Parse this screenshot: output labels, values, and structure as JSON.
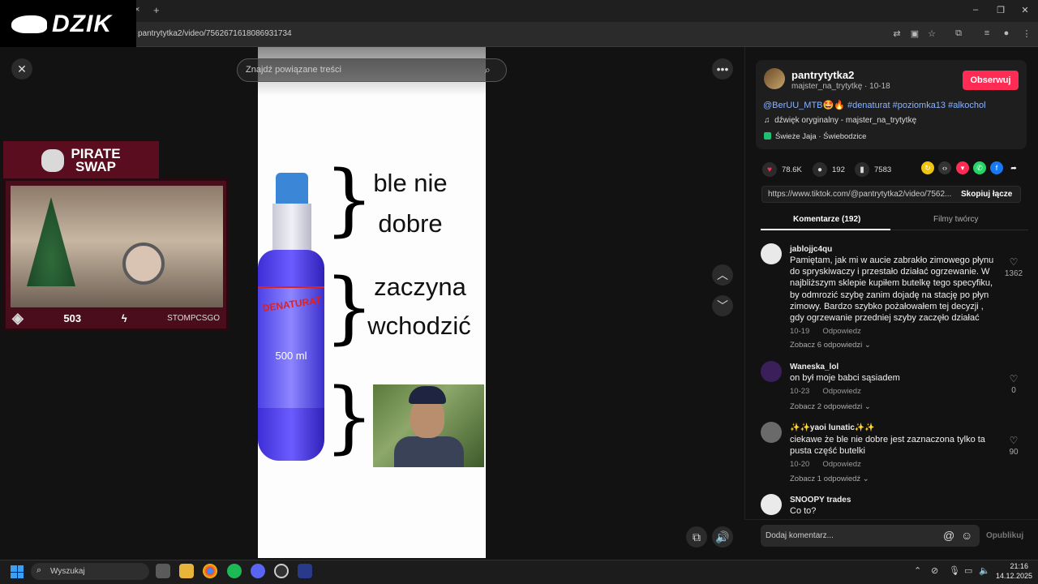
{
  "browser": {
    "url": "pantrytytka2/video/7562671618086931734",
    "new_tab": "+",
    "tab_close": "×",
    "window_controls": [
      "–",
      "❐",
      "✕"
    ]
  },
  "logo": {
    "text": "DZIK"
  },
  "video": {
    "search_placeholder": "Znajdź powiązane treści",
    "meme": {
      "line1a": "ble nie",
      "line1b": "dobre",
      "line2a": "zaczyna",
      "line2b": "wchodzić",
      "bottle_label": "DENATURAT",
      "bottle_volume": "500 ml"
    }
  },
  "stream_overlay": {
    "title_line1": "PIRATE",
    "title_line2": "SWAP",
    "tag": "503",
    "yt_label": "STOMPCSGO"
  },
  "post": {
    "username": "pantrytytka2",
    "subline": "majster_na_trytytkę · 10-18",
    "follow_label": "Obserwuj",
    "caption": "@BerUU_MTB🤩🔥 #denaturat #poziomka13 #alkochol",
    "sound": "dźwięk oryginalny - majster_na_trytytkę",
    "location": "Świeże Jaja · Świebodzice",
    "likes": "78.6K",
    "comments": "192",
    "saves": "7583",
    "link": "https://www.tiktok.com/@pantrytytka2/video/7562...",
    "copy_label": "Skopiuj łącze"
  },
  "tabs": {
    "comments": "Komentarze (192)",
    "creator_videos": "Filmy twórcy"
  },
  "comments": [
    {
      "user": "jablojjc4qu",
      "lines": [
        "Pamiętam, jak mi w aucie zabrakło zimowego płynu",
        "do spryskiwaczy i przestało działać ogrzewanie. W",
        "najbliższym sklepie kupiłem butelkę tego specyfiku,",
        "by odmrozić szybę zanim dojadę na stację po płyn",
        "zimowy. Bardzo szybko pożałowałem tej decyzji ,",
        "gdy ogrzewanie przedniej szyby zaczęło działać"
      ],
      "date": "10-19",
      "reply": "Odpowiedz",
      "replies": "Zobacz 6 odpowiedzi",
      "likes": "1362"
    },
    {
      "user": "Waneska_lol",
      "lines": [
        "on był moje babci sąsiadem"
      ],
      "date": "10-23",
      "reply": "Odpowiedz",
      "replies": "Zobacz 2 odpowiedzi",
      "likes": "0"
    },
    {
      "user": "✨✨yaoi lunatic✨✨",
      "lines": [
        "ciekawe że ble nie dobre jest zaznaczona tylko ta",
        "pusta część butelki"
      ],
      "date": "10-20",
      "reply": "Odpowiedz",
      "replies": "Zobacz 1 odpowiedź",
      "likes": "90"
    },
    {
      "user": "SNOOPY trades",
      "lines": [
        "Co to?"
      ],
      "date": "",
      "reply": "",
      "replies": "",
      "likes": ""
    }
  ],
  "comment_input": {
    "placeholder": "Dodaj komentarz...",
    "publish": "Opublikuj"
  },
  "taskbar": {
    "search": "Wyszukaj",
    "time": "21:16",
    "date": "14.12.2025"
  },
  "colors": {
    "accent": "#fe2c55",
    "hashtag": "#8ab4ff",
    "background": "#121212"
  }
}
